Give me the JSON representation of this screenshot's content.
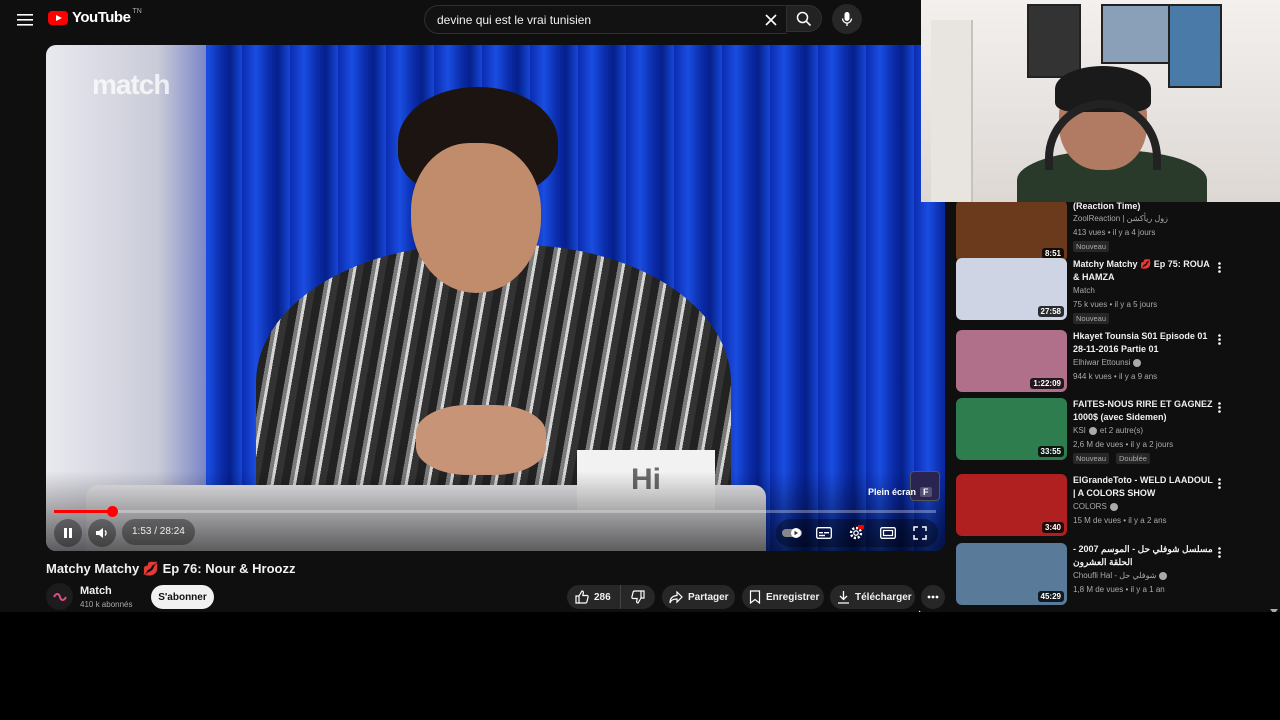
{
  "topbar": {
    "logo_text": "YouTube",
    "logo_sup": "TN",
    "search_value": "devine qui est le vrai tunisien"
  },
  "player": {
    "watermark": "match",
    "card_text": "Hi",
    "fullscreen_tip": "Plein écran",
    "fullscreen_key": "F",
    "time": "1:53 / 28:24",
    "progress_fraction": 0.066
  },
  "video": {
    "title": "Matchy Matchy 💋 Ep 76: Nour & Hroozz",
    "channel": "Match",
    "subscribers": "410 k abonnés",
    "subscribe_label": "S'abonner",
    "likes": "286",
    "share_label": "Partager",
    "save_label": "Enregistrer",
    "download_label": "Télécharger"
  },
  "recommendations": [
    {
      "title": "(Reaction Time)",
      "channel": "ZoolReaction | زول ريأكشن",
      "meta": "413 vues • il y a 4 jours",
      "badge": "Nouveau",
      "duration": "8:51",
      "thumb_color": "#6b3a1c",
      "verified": false
    },
    {
      "title": "Matchy Matchy 💋 Ep 75: ROUA & HAMZA",
      "channel": "Match",
      "meta": "75 k vues • il y a 5 jours",
      "badge": "Nouveau",
      "duration": "27:58",
      "thumb_color": "#cfd4e4",
      "verified": false
    },
    {
      "title": "Hkayet Tounsia S01 Episode 01 28-11-2016 Partie 01",
      "channel": "Elhiwar Ettounsi",
      "meta": "944 k vues • il y a 9 ans",
      "badge": "",
      "duration": "1:22:09",
      "thumb_color": "#b0708a",
      "verified": true
    },
    {
      "title": "FAITES-NOUS RIRE ET GAGNEZ 1000$ (avec Sidemen)",
      "channel": "KSI",
      "channel_extra": "et 2 autre(s)",
      "meta": "2,6 M de vues • il y a 2 jours",
      "badge": "Nouveau",
      "badge2": "Doublée",
      "duration": "33:55",
      "thumb_color": "#2e7d4f",
      "verified": true
    },
    {
      "title": "ElGrandeToto - WELD LAADOUL | A COLORS SHOW",
      "channel": "COLORS",
      "meta": "15 M de vues • il y a 2 ans",
      "badge": "",
      "duration": "3:40",
      "thumb_color": "#b02020",
      "verified": true
    },
    {
      "title": "مسلسل شوفلي حل - الموسم 2007 - الحلقة العشرون",
      "channel": "Choufli Hal - شوفلي حل",
      "meta": "1,8 M de vues • il y a 1 an",
      "badge": "",
      "duration": "45:29",
      "thumb_color": "#5a7a9a",
      "verified": true
    }
  ]
}
